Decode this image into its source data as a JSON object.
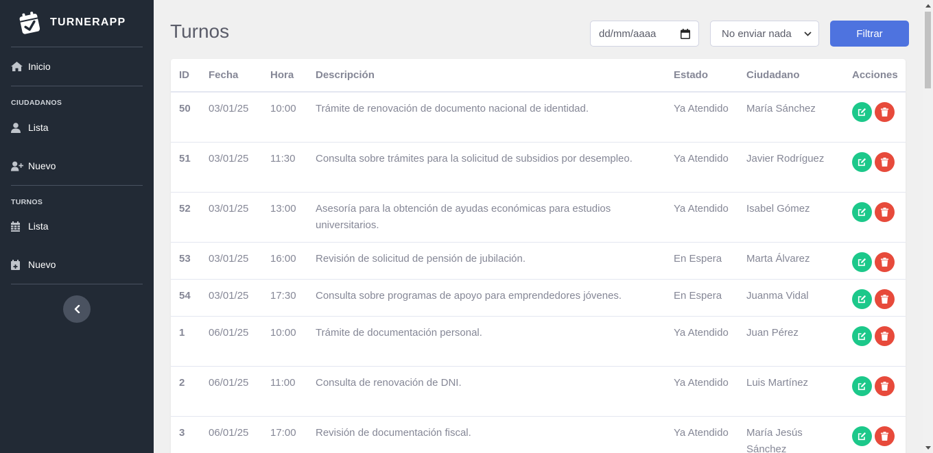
{
  "app": {
    "brand": "TURNERAPP"
  },
  "sidebar": {
    "home_label": "Inicio",
    "sections": [
      {
        "title": "CIUDADANOS",
        "items": [
          {
            "label": "Lista",
            "icon": "user-icon"
          },
          {
            "label": "Nuevo",
            "icon": "user-plus-icon"
          }
        ]
      },
      {
        "title": "TURNOS",
        "items": [
          {
            "label": "Lista",
            "icon": "calendar-icon"
          },
          {
            "label": "Nuevo",
            "icon": "calendar-plus-icon"
          }
        ]
      }
    ]
  },
  "header": {
    "title": "Turnos",
    "date_placeholder": "dd/mm/aaaa",
    "select_value": "No enviar nada",
    "filter_label": "Filtrar"
  },
  "table": {
    "columns": [
      "ID",
      "Fecha",
      "Hora",
      "Descripción",
      "Estado",
      "Ciudadano",
      "Acciones"
    ],
    "rows": [
      {
        "id": "50",
        "fecha": "03/01/25",
        "hora": "10:00",
        "descripcion": "Trámite de renovación de documento nacional de identidad.",
        "estado": "Ya Atendido",
        "ciudadano": "María Sánchez"
      },
      {
        "id": "51",
        "fecha": "03/01/25",
        "hora": "11:30",
        "descripcion": "Consulta sobre trámites para la solicitud de subsidios por desempleo.",
        "estado": "Ya Atendido",
        "ciudadano": "Javier Rodríguez"
      },
      {
        "id": "52",
        "fecha": "03/01/25",
        "hora": "13:00",
        "descripcion": "Asesoría para la obtención de ayudas económicas para estudios universitarios.",
        "estado": "Ya Atendido",
        "ciudadano": "Isabel Gómez"
      },
      {
        "id": "53",
        "fecha": "03/01/25",
        "hora": "16:00",
        "descripcion": "Revisión de solicitud de pensión de jubilación.",
        "estado": "En Espera",
        "ciudadano": "Marta Álvarez"
      },
      {
        "id": "54",
        "fecha": "03/01/25",
        "hora": "17:30",
        "descripcion": "Consulta sobre programas de apoyo para emprendedores jóvenes.",
        "estado": "En Espera",
        "ciudadano": "Juanma Vidal"
      },
      {
        "id": "1",
        "fecha": "06/01/25",
        "hora": "10:00",
        "descripcion": "Trámite de documentación personal.",
        "estado": "Ya Atendido",
        "ciudadano": "Juan Pérez"
      },
      {
        "id": "2",
        "fecha": "06/01/25",
        "hora": "11:00",
        "descripcion": "Consulta de renovación de DNI.",
        "estado": "Ya Atendido",
        "ciudadano": "Luis Martínez"
      },
      {
        "id": "3",
        "fecha": "06/01/25",
        "hora": "17:00",
        "descripcion": "Revisión de documentación fiscal.",
        "estado": "Ya Atendido",
        "ciudadano": "María Jesús Sánchez"
      }
    ]
  },
  "colors": {
    "sidebar_bg": "#222a35",
    "primary": "#4e73df",
    "edit": "#1cc88a",
    "delete": "#e74a3b",
    "text_muted": "#858796"
  }
}
